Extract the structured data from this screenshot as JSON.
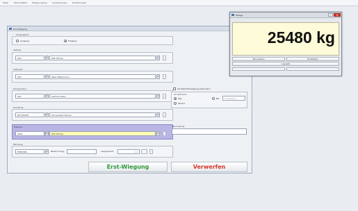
{
  "menu": [
    "Datei",
    "Stammdaten",
    "Wiegevorgang",
    "Auswertungen",
    "Einstellungen"
  ],
  "window": {
    "title": "Erst-Wiegung"
  },
  "movement": {
    "label": "Vorgangsart",
    "options": [
      "Ausgang",
      "Eingang"
    ],
    "selected": "Eingang"
  },
  "contract": {
    "label": "Vertrag",
    "code": "000",
    "name": "SPS Trifrole"
  },
  "supplier": {
    "label": "Lieferant",
    "code": "002",
    "name": "Peter Bittermann"
  },
  "carrier": {
    "label": "Transporteur",
    "code": "001",
    "name": "Gerhard Hahn"
  },
  "driver": {
    "label": "Fuhrfirma",
    "code": "DP139OSD",
    "name": "Hinnersadt Heiners"
  },
  "article": {
    "label": "Material",
    "code": "0001",
    "name": "SPS Trifrole"
  },
  "vehicle": {
    "label": "Fahrzeug",
    "code": "EHNDSEL",
    "desc_label": "Bezeichnung",
    "desc_value": "",
    "tare_label": "Leergewicht",
    "tare_value": "1,0"
  },
  "multi_weigh": {
    "checkbox_label": "als Mehrfachwiegung speichern",
    "period_label": "Im Zeitraum",
    "options": [
      "Tag",
      "Woche"
    ],
    "selected": "Tag",
    "until_label": "Bis",
    "until_date": "15.06.2011"
  },
  "remark": {
    "label": "Bemerkung",
    "value": ""
  },
  "buttons": {
    "first_weigh": "Erst-Wiegung",
    "discard": "Verwerfen"
  },
  "scale": {
    "title": "Waage",
    "weight": "25480 kg",
    "btn_left": "Tara setzen",
    "btn_right": "Nullstellen",
    "btn_center": "Auswahl"
  },
  "colors": {
    "green": "#2f9a3a",
    "red": "#d7372b",
    "highlight": "#b9b6e6",
    "display": "#fdfbd8"
  }
}
